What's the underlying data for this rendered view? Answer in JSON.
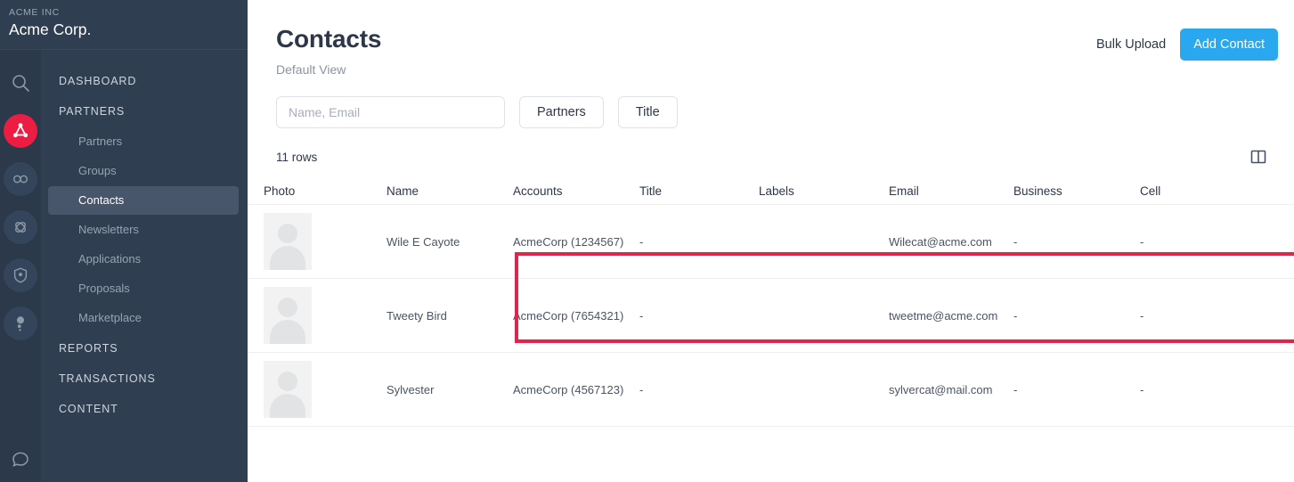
{
  "sidebar": {
    "org_label": "ACME INC",
    "org_name": "Acme Corp.",
    "rail_icons": [
      {
        "name": "search-icon",
        "state": "plain"
      },
      {
        "name": "partners-network-icon",
        "state": "active"
      },
      {
        "name": "infinity-icon",
        "state": "tinted"
      },
      {
        "name": "atom-icon",
        "state": "tinted"
      },
      {
        "name": "shield-icon",
        "state": "tinted"
      },
      {
        "name": "person-icon",
        "state": "tinted"
      },
      {
        "name": "chat-bubble-icon",
        "state": "plain"
      }
    ],
    "nav": [
      {
        "label": "DASHBOARD",
        "type": "section"
      },
      {
        "label": "PARTNERS",
        "type": "section"
      },
      {
        "label": "Partners",
        "type": "sub"
      },
      {
        "label": "Groups",
        "type": "sub"
      },
      {
        "label": "Contacts",
        "type": "sub",
        "selected": true
      },
      {
        "label": "Newsletters",
        "type": "sub"
      },
      {
        "label": "Applications",
        "type": "sub"
      },
      {
        "label": "Proposals",
        "type": "sub"
      },
      {
        "label": "Marketplace",
        "type": "sub"
      },
      {
        "label": "REPORTS",
        "type": "section"
      },
      {
        "label": "TRANSACTIONS",
        "type": "section"
      },
      {
        "label": "CONTENT",
        "type": "section"
      }
    ]
  },
  "header": {
    "title": "Contacts",
    "subtitle": "Default View",
    "bulk_upload_label": "Bulk Upload",
    "add_contact_label": "Add Contact"
  },
  "filters": {
    "search_placeholder": "Name, Email",
    "search_value": "",
    "chips": [
      "Partners",
      "Title"
    ]
  },
  "table": {
    "rows_count_label": "11 rows",
    "columns": [
      "Photo",
      "Name",
      "Accounts",
      "Title",
      "Labels",
      "Email",
      "Business",
      "Cell"
    ],
    "rows": [
      {
        "photo": "avatar-placeholder",
        "name": "Wile E Cayote",
        "accounts": "AcmeCorp (1234567)",
        "title": "-",
        "labels": "",
        "email": "Wilecat@acme.com",
        "business": "-",
        "cell": "-",
        "highlighted": true
      },
      {
        "photo": "avatar-placeholder",
        "name": "Tweety Bird",
        "accounts": "AcmeCorp (7654321)",
        "title": "-",
        "labels": "",
        "email": "tweetme@acme.com",
        "business": "-",
        "cell": "-",
        "highlighted": false
      },
      {
        "photo": "avatar-placeholder",
        "name": "Sylvester",
        "accounts": "AcmeCorp (4567123)",
        "title": "-",
        "labels": "",
        "email": "sylvercat@mail.com",
        "business": "-",
        "cell": "-",
        "highlighted": false
      }
    ]
  },
  "colors": {
    "sidebar_bg": "#2f3e51",
    "rail_bg": "#2b394b",
    "accent_red": "#ec1c43",
    "annotation_red": "#e0244e",
    "primary_blue": "#29a8ef",
    "selected_nav_bg": "#47566b"
  }
}
